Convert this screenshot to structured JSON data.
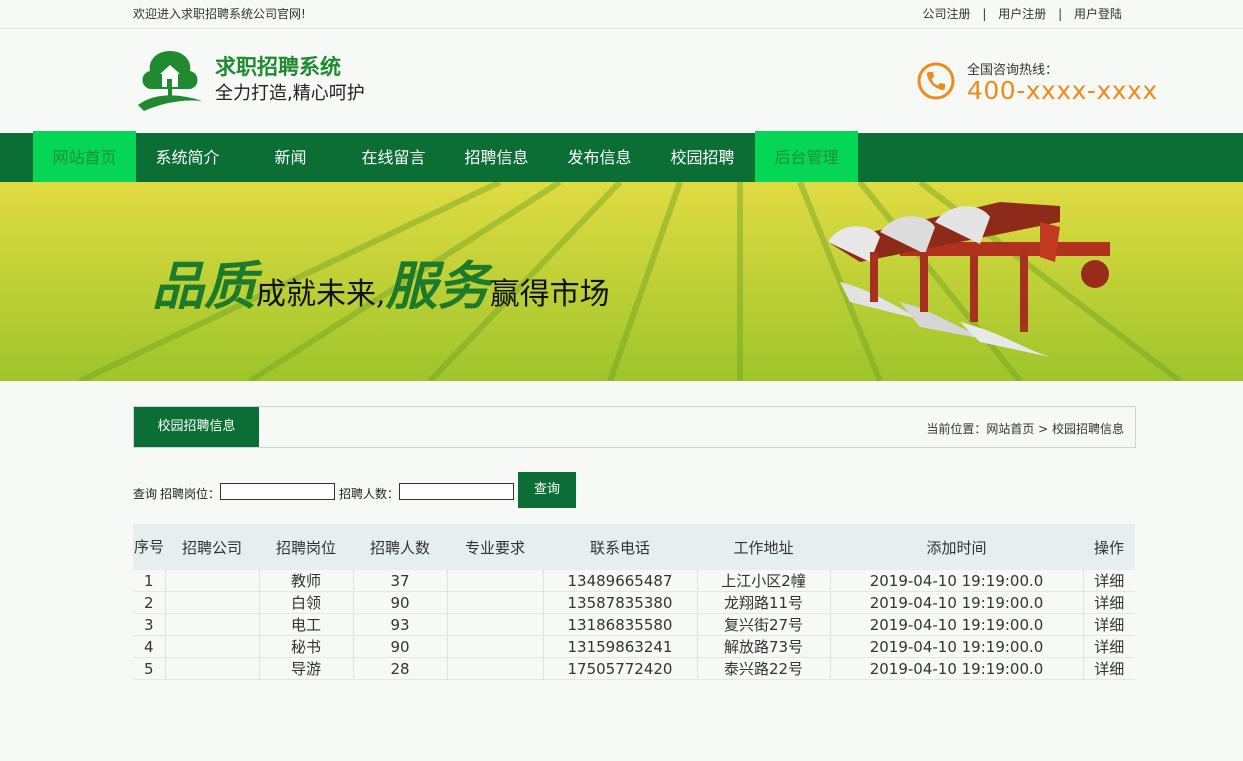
{
  "topbar": {
    "welcome": "欢迎进入求职招聘系统公司官网!",
    "links": [
      "公司注册",
      "用户注册",
      "用户登陆"
    ],
    "separator": "|"
  },
  "header": {
    "site_name": "求职招聘系统",
    "slogan": "全力打造,精心呵护",
    "hotline_label": "全国咨询热线：",
    "hotline_number": "400-xxxx-xxxx",
    "logo_icon": "house-tree-logo-icon",
    "phone_icon": "phone-icon"
  },
  "nav": {
    "items": [
      {
        "label": "网站首页",
        "active": true
      },
      {
        "label": "系统简介",
        "active": false
      },
      {
        "label": "新闻",
        "active": false
      },
      {
        "label": "在线留言",
        "active": false
      },
      {
        "label": "招聘信息",
        "active": false
      },
      {
        "label": "发布信息",
        "active": false
      },
      {
        "label": "校园招聘",
        "active": false
      },
      {
        "label": "后台管理",
        "active": true
      }
    ]
  },
  "banner": {
    "text_big1": "品质",
    "text_small1": "成就未来,",
    "text_big2": "服务",
    "text_small2": "赢得市场"
  },
  "section": {
    "title": "校园招聘信息",
    "breadcrumb": "当前位置：网站首页 > 校园招聘信息"
  },
  "search": {
    "prefix": "查询",
    "position_label": "招聘岗位：",
    "position_value": "",
    "count_label": "招聘人数：",
    "count_value": "",
    "button": "查询"
  },
  "table": {
    "headers": [
      "序号",
      "招聘公司",
      "招聘岗位",
      "招聘人数",
      "专业要求",
      "联系电话",
      "工作地址",
      "添加时间",
      "操作"
    ],
    "rows": [
      [
        "1",
        "",
        "教师",
        "37",
        "",
        "13489665487",
        "上江小区2幢",
        "2019-04-10 19:19:00.0",
        "详细"
      ],
      [
        "2",
        "",
        "白领",
        "90",
        "",
        "13587835380",
        "龙翔路11号",
        "2019-04-10 19:19:00.0",
        "详细"
      ],
      [
        "3",
        "",
        "电工",
        "93",
        "",
        "13186835580",
        "复兴街27号",
        "2019-04-10 19:19:00.0",
        "详细"
      ],
      [
        "4",
        "",
        "秘书",
        "90",
        "",
        "13159863241",
        "解放路73号",
        "2019-04-10 19:19:00.0",
        "详细"
      ],
      [
        "5",
        "",
        "导游",
        "28",
        "",
        "17505772420",
        "泰兴路22号",
        "2019-04-10 19:19:00.0",
        "详细"
      ]
    ]
  },
  "colors": {
    "nav_bg": "#0b6e34",
    "nav_active": "#06d655",
    "brand_green": "#1f8a2f",
    "hotline_orange": "#f08a1c"
  }
}
